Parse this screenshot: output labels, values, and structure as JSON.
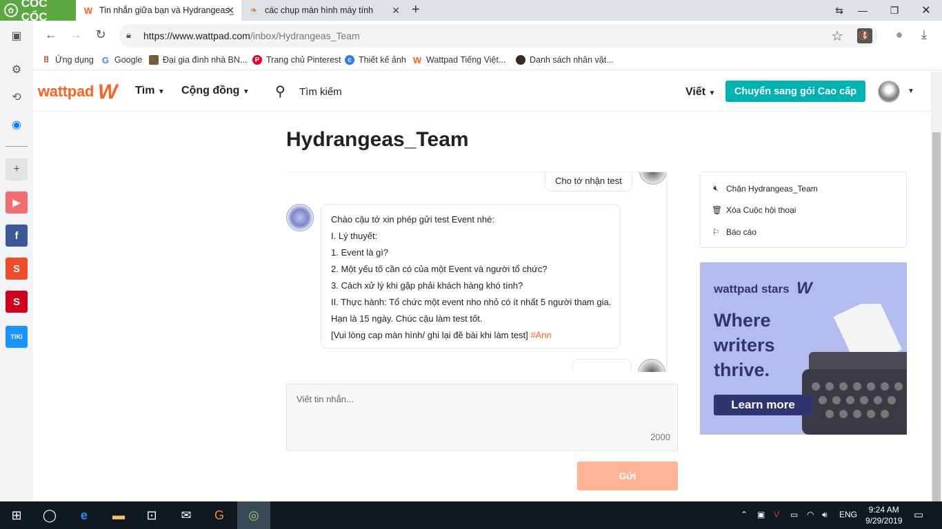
{
  "browser": {
    "brand": "CỐC CỐC",
    "tabs": [
      {
        "title": "Tin nhắn giữa bạn và Hydrangeas_",
        "active": true
      },
      {
        "title": "các chụp màn hình máy tính",
        "active": false
      }
    ],
    "url_host": "https://www.wattpad.com",
    "url_path": "/inbox/Hydrangeas_Team",
    "bookmarks": [
      "Ứng dụng",
      "Google",
      "Đại gia đình nhà BN...",
      "Trang chủ Pinterest",
      "Thiết kế ảnh",
      "Wattpad Tiếng Việt...",
      "Danh sách nhân vật..."
    ]
  },
  "header": {
    "logo": "wattpad",
    "nav_find": "Tìm",
    "nav_community": "Cộng đồng",
    "search": "Tìm kiếm",
    "language": "Viết",
    "premium_button": "Chuyển sang gói Cao cấp"
  },
  "page": {
    "title": "Hydrangeas_Team"
  },
  "messages": {
    "sent_top": "Cho tớ nhận test",
    "received": {
      "lines": [
        "Chào cậu tớ xin phép gửi test Event nhé:",
        "I. Lý thuyết:",
        "1. Event là gì?",
        "2. Một yếu tố cần có của một Event và người tổ chức?",
        "3. Cách xử lý khi gặp phải khách hàng khó tính?",
        "II. Thực hành: Tổ chức một event nho nhỏ có ít nhất 5 người tham gia.",
        "Hạn là 15 ngày. Chúc cậu làm test tốt."
      ],
      "last_line": "[Vui lòng cap màn hình/ ghi lại đề bài khi làm test]",
      "tag": "#Ann"
    }
  },
  "compose": {
    "placeholder": "Viết tin nhắn...",
    "char_limit": "2000",
    "send_button": "Gửi"
  },
  "options": {
    "block": "Chặn Hydrangeas_Team",
    "delete": "Xóa Cuộc hội thoại",
    "report": "Báo cáo"
  },
  "ad": {
    "brand": "wattpad stars",
    "headline_1": "Where",
    "headline_2": "writers",
    "headline_3": "thrive.",
    "cta": "Learn more"
  },
  "taskbar": {
    "language": "ENG",
    "time": "9:24 AM",
    "date": "9/29/2019"
  },
  "colors": {
    "wattpad_orange": "#ff6122",
    "teal": "#00b2b2",
    "send_disabled": "#ffb394",
    "ad_bg": "#b3bcef",
    "ad_ink": "#2f3570"
  }
}
